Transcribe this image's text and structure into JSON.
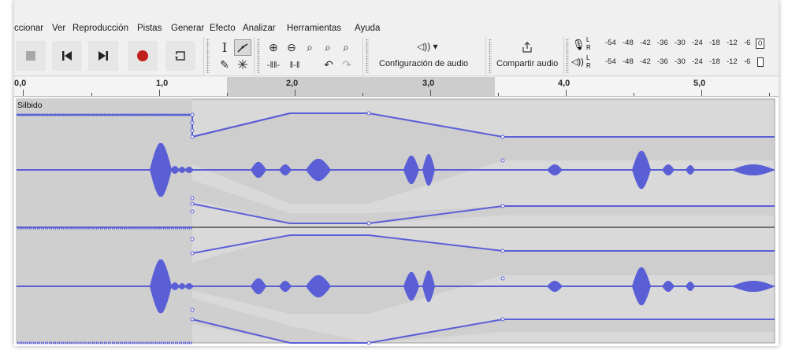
{
  "menu": [
    "ccionar",
    "Ver",
    "Reproducción",
    "Pistas",
    "Generar",
    "Efecto",
    "Analizar",
    "Herramientas",
    "Ayuda"
  ],
  "toolbar": {
    "audio_setup_label": "Configuración de audio",
    "share_label": "Compartir audio"
  },
  "meters": {
    "record_channel_top": "L",
    "record_channel_bottom": "R",
    "play_channel_top": "L",
    "play_channel_bottom": "R",
    "record_scale": [
      "-54",
      "-48",
      "-42",
      "-36",
      "-30",
      "-24",
      "-18",
      "-12",
      "-6",
      "0"
    ],
    "play_scale": [
      "-54",
      "-48",
      "-42",
      "-36",
      "-30",
      "-24",
      "-18",
      "-12",
      "-6"
    ]
  },
  "ruler": {
    "labels": [
      "0,0",
      "1,0",
      "2,0",
      "3,0",
      "4,0",
      "5,0"
    ]
  },
  "track": {
    "name": "Silbido"
  },
  "colors": {
    "waveform": "#5a5fd6",
    "envelope": "#5a5fd6",
    "record": "#c0221b",
    "selection": "#cdcdcd",
    "envelope_band": "#c4c4c4"
  }
}
